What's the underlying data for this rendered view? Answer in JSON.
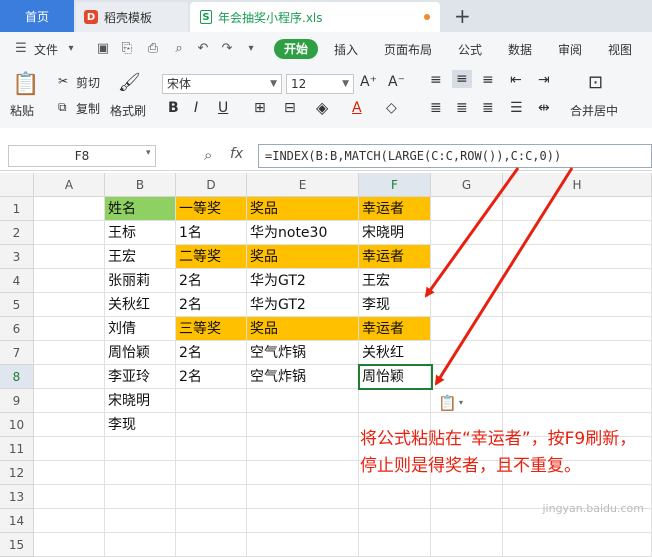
{
  "tabs": {
    "home": "首页",
    "daoke": "稻壳模板",
    "file": "年会抽奖小程序.xls"
  },
  "menu": {
    "file": "文件",
    "start": "开始",
    "insert": "插入",
    "layout": "页面布局",
    "formula": "公式",
    "data": "数据",
    "review": "审阅",
    "view": "视图"
  },
  "ribbon": {
    "paste": "粘贴",
    "cut": "剪切",
    "copy": "复制",
    "format_painter": "格式刷",
    "font": "宋体",
    "size": "12",
    "merge": "合并居中"
  },
  "formula_bar": {
    "name_box": "F8",
    "fx": "fx",
    "formula": "=INDEX(B:B,MATCH(LARGE(C:C,ROW()),C:C,0))"
  },
  "columns": [
    "A",
    "B",
    "D",
    "E",
    "F",
    "G",
    "H"
  ],
  "rows": [
    "1",
    "2",
    "3",
    "4",
    "5",
    "6",
    "7",
    "8",
    "9",
    "10",
    "11",
    "12",
    "13",
    "14",
    "15"
  ],
  "table": {
    "B": [
      "姓名",
      "王标",
      "王宏",
      "张丽莉",
      "关秋红",
      "刘倩",
      "周怡颖",
      "李亚玲",
      "宋晓明",
      "李现"
    ],
    "D": [
      "一等奖",
      "1名",
      "二等奖",
      "2名",
      "2名",
      "三等奖",
      "2名",
      "2名"
    ],
    "E": [
      "奖品",
      "华为note30",
      "奖品",
      "华为GT2",
      "华为GT2",
      "奖品",
      "空气炸锅",
      "空气炸锅"
    ],
    "F": [
      "幸运者",
      "宋晓明",
      "幸运者",
      "王宏",
      "李现",
      "幸运者",
      "关秋红",
      "周怡颖"
    ]
  },
  "note": "将公式粘贴在“幸运者”，按F9刷新，停止则是得奖者，且不重复。",
  "watermark": "jingyan.baidu.com",
  "colors": {
    "green": "#8fd062",
    "orange": "#ffc000",
    "accent": "#2ea043",
    "arrow": "#e8210f"
  }
}
